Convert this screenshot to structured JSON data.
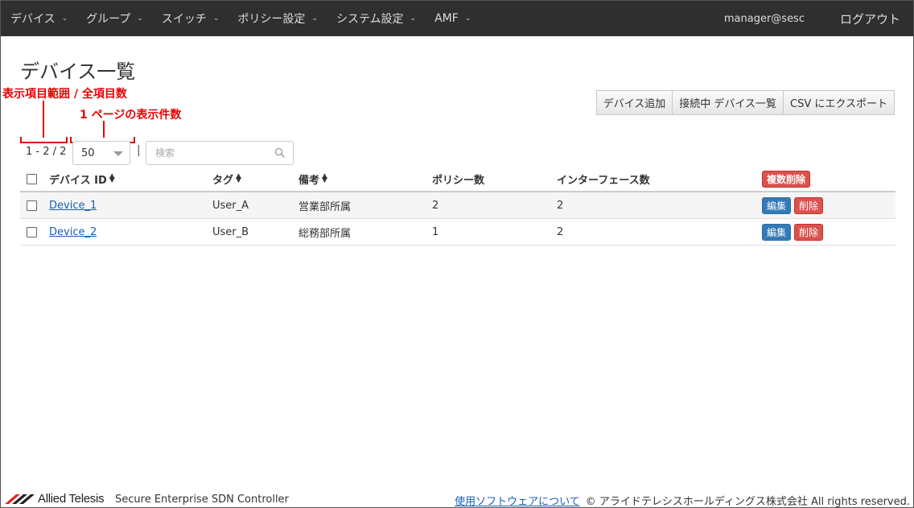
{
  "nav": {
    "items": [
      {
        "label": "デバイス"
      },
      {
        "label": "グループ"
      },
      {
        "label": "スイッチ"
      },
      {
        "label": "ポリシー設定"
      },
      {
        "label": "システム設定"
      },
      {
        "label": "AMF"
      }
    ],
    "caret": "⌄",
    "user": "manager@sesc",
    "logout": "ログアウト"
  },
  "page": {
    "title": "デバイス一覧"
  },
  "annotations": {
    "range": "表示項目範囲 / 全項目数",
    "per_page": "1 ページの表示件数",
    "color": "#e60000"
  },
  "toolbar": {
    "add": "デバイス追加",
    "connected": "接続中 デバイス一覧",
    "export": "CSV にエクスポート"
  },
  "pager": {
    "range": "1 - 2 / 2",
    "per_page": "50",
    "separator": "|",
    "search_placeholder": "検索"
  },
  "table": {
    "headers": {
      "device_id": "デバイス ID",
      "tag": "タグ",
      "note": "備考",
      "policy_count": "ポリシー数",
      "interface_count": "インターフェース数",
      "bulk_delete": "複数削除"
    },
    "sort_glyph_up": "▲",
    "sort_glyph_down": "▼",
    "rows": [
      {
        "device_id": "Device_1",
        "tag": "User_A",
        "note": "営業部所属",
        "policy_count": "2",
        "interface_count": "2",
        "edit": "編集",
        "delete": "削除"
      },
      {
        "device_id": "Device_2",
        "tag": "User_B",
        "note": "総務部所属",
        "policy_count": "1",
        "interface_count": "2",
        "edit": "編集",
        "delete": "削除"
      }
    ]
  },
  "footer": {
    "brand": "Allied Telesis",
    "product": "Secure Enterprise SDN Controller",
    "software_link": "使用ソフトウェアについて",
    "copyright": "© アライドテレシスホールディングス株式会社 All rights reserved."
  },
  "colors": {
    "navbar": "#2f2f2f",
    "link": "#1a5fb4",
    "danger": "#d9534f",
    "primary": "#337ab7",
    "logo_red": "#e0261b"
  }
}
